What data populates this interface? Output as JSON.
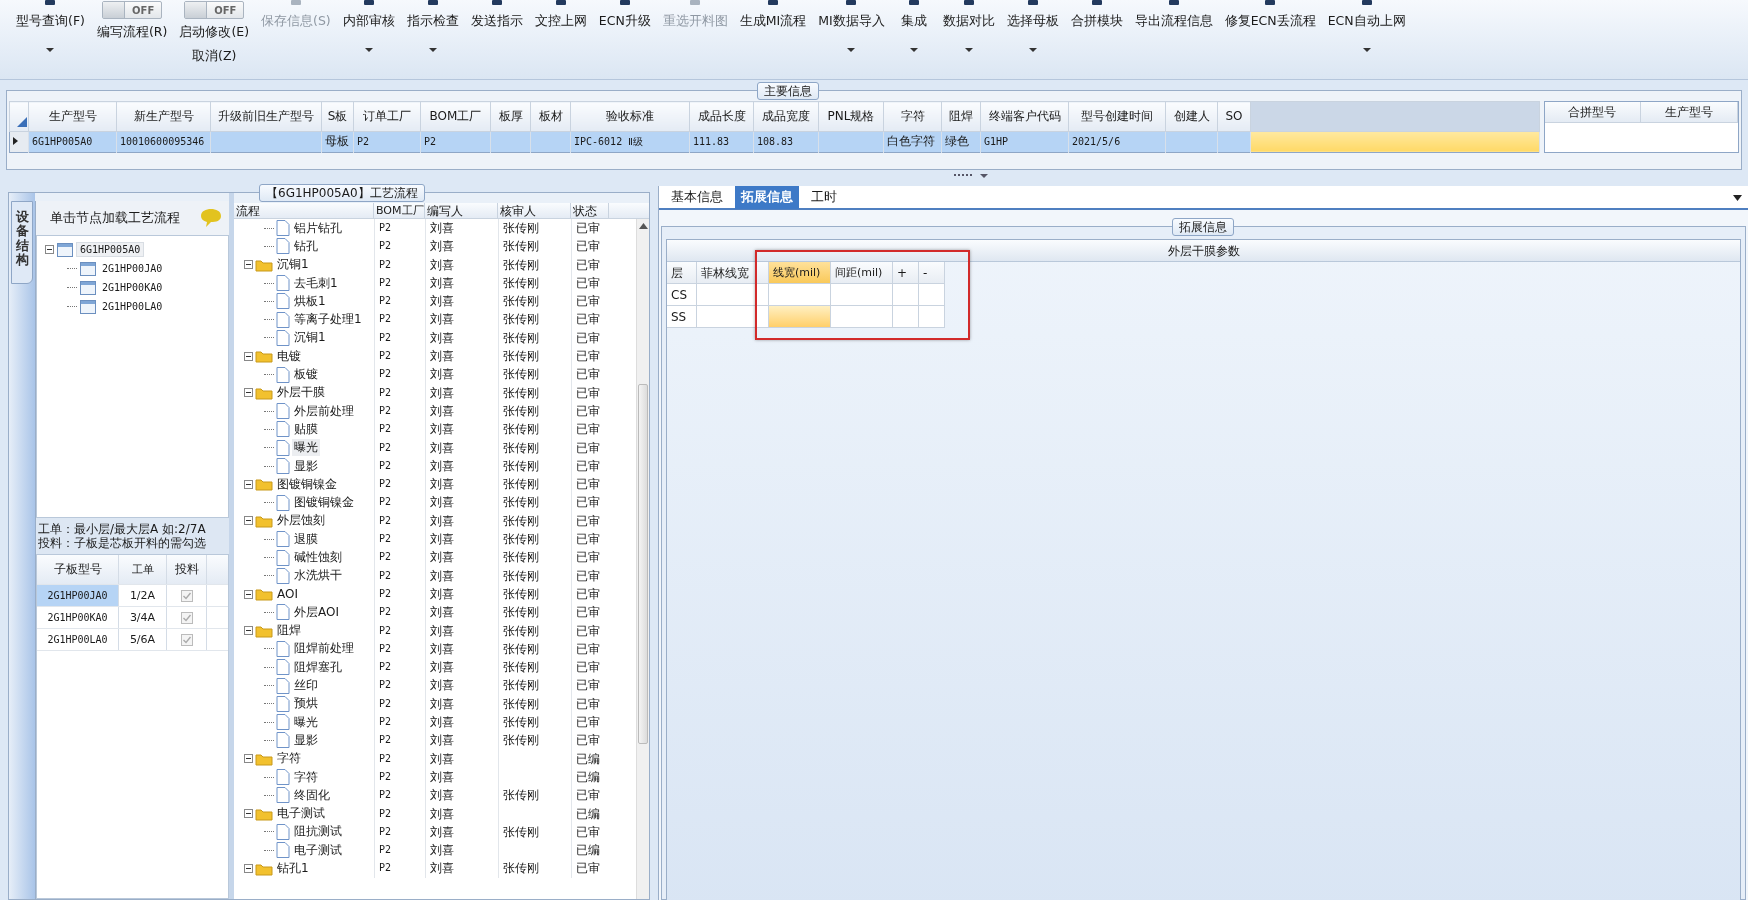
{
  "toolbar": [
    {
      "kind": "button",
      "label": "型号查询(F)",
      "dropdown": true,
      "disabled": false
    },
    {
      "kind": "toggle",
      "switch": "OFF",
      "label": "编写流程(R)"
    },
    {
      "kind": "toggle",
      "switch": "OFF",
      "label": "启动修改(E)",
      "sublabel": "取消(Z)"
    },
    {
      "kind": "button",
      "label": "保存信息(S)",
      "dropdown": false,
      "disabled": true
    },
    {
      "kind": "button",
      "label": "内部审核",
      "dropdown": true,
      "disabled": false
    },
    {
      "kind": "button",
      "label": "指示检查",
      "dropdown": true,
      "disabled": false
    },
    {
      "kind": "button",
      "label": "发送指示",
      "dropdown": false,
      "disabled": false
    },
    {
      "kind": "button",
      "label": "文控上网",
      "dropdown": false,
      "disabled": false
    },
    {
      "kind": "button",
      "label": "ECN升级",
      "dropdown": false,
      "disabled": false
    },
    {
      "kind": "button",
      "label": "重选开料图",
      "dropdown": false,
      "disabled": true
    },
    {
      "kind": "button",
      "label": "生成MI流程",
      "dropdown": false,
      "disabled": false
    },
    {
      "kind": "button",
      "label": "MI数据导入",
      "dropdown": true,
      "disabled": false
    },
    {
      "kind": "button",
      "label": "集成",
      "dropdown": true,
      "disabled": false
    },
    {
      "kind": "button",
      "label": "数据对比",
      "dropdown": true,
      "disabled": false
    },
    {
      "kind": "button",
      "label": "选择母板",
      "dropdown": true,
      "disabled": false
    },
    {
      "kind": "button",
      "label": "合拼模块",
      "dropdown": false,
      "disabled": false
    },
    {
      "kind": "button",
      "label": "导出流程信息",
      "dropdown": false,
      "disabled": false
    },
    {
      "kind": "button",
      "label": "修复ECN丢流程",
      "dropdown": false,
      "disabled": false
    },
    {
      "kind": "button",
      "label": "ECN自动上网",
      "dropdown": true,
      "disabled": false
    }
  ],
  "main_info": {
    "title": "主要信息",
    "columns": [
      "生产型号",
      "新生产型号",
      "升级前旧生产型号",
      "S板",
      "订单工厂",
      "BOM工厂",
      "板厚",
      "板材",
      "验收标准",
      "成品长度",
      "成品宽度",
      "PNL规格",
      "字符",
      "阻焊",
      "终端客户代码",
      "型号创建时间",
      "创建人",
      "SO"
    ],
    "rows": [
      {
        "selected": true,
        "cells": [
          "6G1HP005A0",
          "10010600095346",
          null,
          "母板",
          "P2",
          "P2",
          null,
          null,
          "IPC-6012 Ⅱ级",
          "111.83",
          "108.83",
          null,
          "白色字符",
          "绿色",
          "G1HP",
          "2021/5/6",
          null,
          null
        ]
      }
    ],
    "merge_columns": [
      "合拼型号",
      "生产型号"
    ]
  },
  "process_panel": {
    "title": "【6G1HP005A0】工艺流程",
    "side_tab": "设备结构",
    "hint": "单击节点加载工艺流程",
    "tree": [
      {
        "label": "6G1HP005A0",
        "expanded": true,
        "selected": true,
        "children": [
          {
            "label": "2G1HP00JA0",
            "selected": false
          },
          {
            "label": "2G1HP00KA0",
            "selected": false
          },
          {
            "label": "2G1HP00LA0",
            "selected": false
          }
        ]
      }
    ],
    "note": [
      "工单：最小层/最大层A 如:2/7A",
      "投料：子板是芯板开料的需勾选"
    ],
    "sub_board_columns": [
      "子板型号",
      "工单",
      "投料"
    ],
    "sub_boards": [
      {
        "model": "2G1HP00JA0",
        "order": "1/2A",
        "checked": true,
        "selected": true
      },
      {
        "model": "2G1HP00KA0",
        "order": "3/4A",
        "checked": true,
        "selected": false
      },
      {
        "model": "2G1HP00LA0",
        "order": "5/6A",
        "checked": true,
        "selected": false
      }
    ],
    "flow_columns": [
      "流程",
      "BOM工厂",
      "编写人",
      "核审人",
      "状态"
    ],
    "flow": [
      {
        "children": [
          {
            "name": "铝片钻孔",
            "bom": "P2",
            "writer": "刘喜",
            "reviewer": "张传刚",
            "status": "已审",
            "selected": false
          },
          {
            "name": "钻孔",
            "bom": "P2",
            "writer": "刘喜",
            "reviewer": "张传刚",
            "status": "已审",
            "selected": false
          }
        ]
      },
      {
        "name": "沉铜1",
        "bom": "P2",
        "writer": "刘喜",
        "reviewer": "张传刚",
        "status": "已审",
        "selected": false,
        "expanded": true,
        "children": [
          {
            "name": "去毛刺1",
            "bom": "P2",
            "writer": "刘喜",
            "reviewer": "张传刚",
            "status": "已审",
            "selected": false
          },
          {
            "name": "烘板1",
            "bom": "P2",
            "writer": "刘喜",
            "reviewer": "张传刚",
            "status": "已审",
            "selected": false
          },
          {
            "name": "等离子处理1",
            "bom": "P2",
            "writer": "刘喜",
            "reviewer": "张传刚",
            "status": "已审",
            "selected": false
          },
          {
            "name": "沉铜1",
            "bom": "P2",
            "writer": "刘喜",
            "reviewer": "张传刚",
            "status": "已审",
            "selected": false
          }
        ]
      },
      {
        "name": "电镀",
        "bom": "P2",
        "writer": "刘喜",
        "reviewer": "张传刚",
        "status": "已审",
        "selected": false,
        "expanded": true,
        "children": [
          {
            "name": "板镀",
            "bom": "P2",
            "writer": "刘喜",
            "reviewer": "张传刚",
            "status": "已审",
            "selected": false
          }
        ]
      },
      {
        "name": "外层干膜",
        "bom": "P2",
        "writer": "刘喜",
        "reviewer": "张传刚",
        "status": "已审",
        "selected": false,
        "expanded": true,
        "children": [
          {
            "name": "外层前处理",
            "bom": "P2",
            "writer": "刘喜",
            "reviewer": "张传刚",
            "status": "已审",
            "selected": false
          },
          {
            "name": "贴膜",
            "bom": "P2",
            "writer": "刘喜",
            "reviewer": "张传刚",
            "status": "已审",
            "selected": false
          },
          {
            "name": "曝光",
            "bom": "P2",
            "writer": "刘喜",
            "reviewer": "张传刚",
            "status": "已审",
            "selected": true
          },
          {
            "name": "显影",
            "bom": "P2",
            "writer": "刘喜",
            "reviewer": "张传刚",
            "status": "已审",
            "selected": false
          }
        ]
      },
      {
        "name": "图镀铜镍金",
        "bom": "P2",
        "writer": "刘喜",
        "reviewer": "张传刚",
        "status": "已审",
        "selected": false,
        "expanded": true,
        "children": [
          {
            "name": "图镀铜镍金",
            "bom": "P2",
            "writer": "刘喜",
            "reviewer": "张传刚",
            "status": "已审",
            "selected": false
          }
        ]
      },
      {
        "name": "外层蚀刻",
        "bom": "P2",
        "writer": "刘喜",
        "reviewer": "张传刚",
        "status": "已审",
        "selected": false,
        "expanded": true,
        "children": [
          {
            "name": "退膜",
            "bom": "P2",
            "writer": "刘喜",
            "reviewer": "张传刚",
            "status": "已审",
            "selected": false
          },
          {
            "name": "碱性蚀刻",
            "bom": "P2",
            "writer": "刘喜",
            "reviewer": "张传刚",
            "status": "已审",
            "selected": false
          },
          {
            "name": "水洗烘干",
            "bom": "P2",
            "writer": "刘喜",
            "reviewer": "张传刚",
            "status": "已审",
            "selected": false
          }
        ]
      },
      {
        "name": "AOI",
        "bom": "P2",
        "writer": "刘喜",
        "reviewer": "张传刚",
        "status": "已审",
        "selected": false,
        "expanded": true,
        "children": [
          {
            "name": "外层AOI",
            "bom": "P2",
            "writer": "刘喜",
            "reviewer": "张传刚",
            "status": "已审",
            "selected": false
          }
        ]
      },
      {
        "name": "阻焊",
        "bom": "P2",
        "writer": "刘喜",
        "reviewer": "张传刚",
        "status": "已审",
        "selected": false,
        "expanded": true,
        "children": [
          {
            "name": "阻焊前处理",
            "bom": "P2",
            "writer": "刘喜",
            "reviewer": "张传刚",
            "status": "已审",
            "selected": false
          },
          {
            "name": "阻焊塞孔",
            "bom": "P2",
            "writer": "刘喜",
            "reviewer": "张传刚",
            "status": "已审",
            "selected": false
          },
          {
            "name": "丝印",
            "bom": "P2",
            "writer": "刘喜",
            "reviewer": "张传刚",
            "status": "已审",
            "selected": false
          },
          {
            "name": "预烘",
            "bom": "P2",
            "writer": "刘喜",
            "reviewer": "张传刚",
            "status": "已审",
            "selected": false
          },
          {
            "name": "曝光",
            "bom": "P2",
            "writer": "刘喜",
            "reviewer": "张传刚",
            "status": "已审",
            "selected": false
          },
          {
            "name": "显影",
            "bom": "P2",
            "writer": "刘喜",
            "reviewer": "张传刚",
            "status": "已审",
            "selected": false
          }
        ]
      },
      {
        "name": "字符",
        "bom": "P2",
        "writer": "刘喜",
        "status": "已编",
        "selected": false,
        "expanded": true,
        "children": [
          {
            "name": "字符",
            "bom": "P2",
            "writer": "刘喜",
            "status": "已编",
            "selected": false
          },
          {
            "name": "终固化",
            "bom": "P2",
            "writer": "刘喜",
            "reviewer": "张传刚",
            "status": "已审",
            "selected": false
          }
        ]
      },
      {
        "name": "电子测试",
        "bom": "P2",
        "writer": "刘喜",
        "status": "已编",
        "selected": false,
        "expanded": true,
        "children": [
          {
            "name": "阻抗测试",
            "bom": "P2",
            "writer": "刘喜",
            "reviewer": "张传刚",
            "status": "已审",
            "selected": false
          },
          {
            "name": "电子测试",
            "bom": "P2",
            "writer": "刘喜",
            "status": "已编",
            "selected": false
          }
        ]
      },
      {
        "name": "钻孔1",
        "bom": "P2",
        "writer": "刘喜",
        "reviewer": "张传刚",
        "status": "已审",
        "selected": false,
        "expanded": true
      }
    ]
  },
  "detail_panel": {
    "tabs": [
      {
        "label": "基本信息",
        "selected": false
      },
      {
        "label": "拓展信息",
        "selected": true
      },
      {
        "label": "工时",
        "selected": false
      }
    ],
    "group_title": "拓展信息",
    "grid_title": "外层干膜参数",
    "columns": [
      {
        "label": "层",
        "selected": false
      },
      {
        "label": "菲林线宽",
        "selected": false
      },
      {
        "label": "线宽(mil)",
        "selected": true
      },
      {
        "label": "间距(mil)",
        "selected": false
      },
      {
        "label": "+",
        "selected": false
      },
      {
        "label": "-",
        "selected": false
      }
    ],
    "rows": [
      {
        "layer": "CS",
        "selected": false
      },
      {
        "layer": "SS",
        "selected": true
      }
    ]
  }
}
